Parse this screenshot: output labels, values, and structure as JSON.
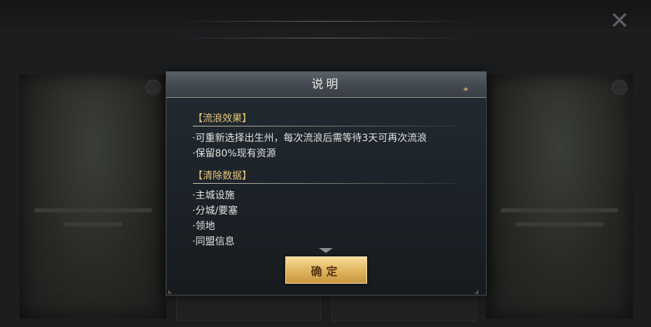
{
  "background": {
    "title": "",
    "left_card_title": "",
    "right_card_title": ""
  },
  "dialog": {
    "title": "说明",
    "sections": [
      {
        "heading": "【流浪效果】",
        "items": [
          "·可重新选择出生州，每次流浪后需等待3天可再次流浪",
          "·保留80%现有资源"
        ]
      },
      {
        "heading": "【清除数据】",
        "items": [
          "·主城设施",
          "·分城/要塞",
          "·领地",
          "·同盟信息"
        ]
      }
    ],
    "confirm_label": "确定"
  },
  "icons": {
    "close": "close-x-icon",
    "scroll_more": "chevron-down-icon"
  },
  "colors": {
    "heading": "#e3c579",
    "body_text": "#e2e2de",
    "button_gold": "#e2bb66",
    "button_text": "#5a3312"
  }
}
